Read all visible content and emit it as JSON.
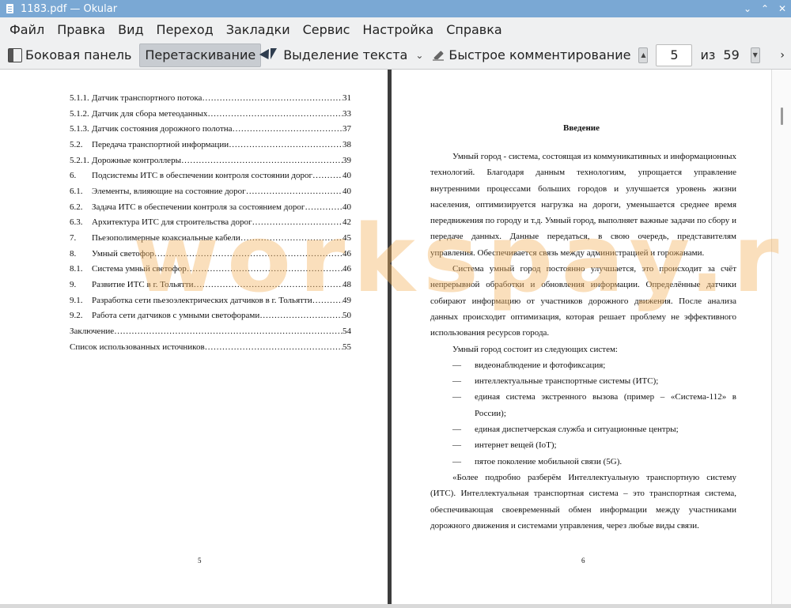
{
  "window": {
    "title": "1183.pdf  — Okular",
    "controls": [
      "chevron-down",
      "chevron-up",
      "close"
    ]
  },
  "menu": [
    "Файл",
    "Правка",
    "Вид",
    "Переход",
    "Закладки",
    "Сервис",
    "Настройка",
    "Справка"
  ],
  "toolbar": {
    "sidebar_label": "Боковая панель",
    "browse_label": "Перетаскивание",
    "text_select_label": "Выделение текста",
    "annotate_label": "Быстрое комментирование",
    "page_current": "5",
    "page_of": "из",
    "page_total": "59"
  },
  "left_page": {
    "toc": [
      {
        "num": "5.1.1.",
        "title": "Датчик транспортного потока",
        "page": "31"
      },
      {
        "num": "5.1.2.",
        "title": "Датчик для сбора метеоданных",
        "page": "33"
      },
      {
        "num": "5.1.3.",
        "title": "Датчик состояния дорожного полотна",
        "page": "37"
      },
      {
        "num": "5.2.",
        "title": "Передача транспортной информации",
        "page": "38"
      },
      {
        "num": "5.2.1.",
        "title": "Дорожные контроллеры",
        "page": "39"
      },
      {
        "num": "6.",
        "title": "Подсистемы ИТС в обеспечении контроля состоянии дорог",
        "page": "40"
      },
      {
        "num": "6.1.",
        "title": "Элементы, влияющие на состояние дорог",
        "page": "40"
      },
      {
        "num": "6.2.",
        "title": "Задача ИТС в обеспечении контроля за состоянием дорог",
        "page": "40"
      },
      {
        "num": "6.3.",
        "title": "Архитектура ИТС для строительства дорог",
        "page": "42"
      },
      {
        "num": "7.",
        "title": "Пьезополимерные коаксиальные кабели",
        "page": "45"
      },
      {
        "num": "8.",
        "title": "Умный светофор",
        "page": "46"
      },
      {
        "num": "8.1.",
        "title": "Система умный светофор",
        "page": "46"
      },
      {
        "num": "9.",
        "title": "Развитие ИТС в г. Тольятти",
        "page": "48"
      },
      {
        "num": "9.1.",
        "title": "Разработка сети пьезоэлектрических датчиков в г. Тольятти",
        "page": "49"
      },
      {
        "num": "9.2.",
        "title": "Работа сети датчиков с умными светофорами",
        "page": "50"
      },
      {
        "num": "",
        "title": "Заключение",
        "page": "54"
      },
      {
        "num": "",
        "title": "Список использованных источников",
        "page": "55"
      }
    ],
    "page_number": "5"
  },
  "right_page": {
    "heading": "Введение",
    "para1": "Умный город - система, состоящая из коммуникативных и информационных технологий. Благодаря данным технологиям, упрощается управление внутренними процессами больших городов и улучшается уровень жизни населения, оптимизируется нагрузка на дороги, уменьшается среднее время передвижения по городу и т.д. Умный город, выполняет важные задачи по сбору и передаче данных. Данные передаться, в свою очередь, представителям управления. Обеспечивается связь между администрацией и горожанами.",
    "para2": "Система умный город постоянно улучшается, это происходит за счёт непрерывной обработки и обновления информации. Определённые датчики собирают информацию от участников дорожного движения. После анализа данных происходит оптимизация, которая решает проблему не эффективного использования ресурсов города.",
    "para3": "Умный город состоит из следующих систем:",
    "list": [
      "видеонаблюдение и фотофиксация;",
      "интеллектуальные транспортные системы (ИТС);",
      "единая система экстренного вызова (пример – «Система-112» в России);",
      "единая диспетчерская служба и ситуационные центры;",
      "интернет вещей (IoT);",
      "пятое поколение мобильной связи (5G)."
    ],
    "para4": "«Более подробно разберём Интеллектуальную транспортную систему (ИТС). Интеллектуальная транспортная система – это транспортная система, обеспечивающая своевременный обмен информации между участниками дорожного движения и системами управления, через любые виды связи.",
    "page_number": "6"
  },
  "watermark": "workspay.ru"
}
